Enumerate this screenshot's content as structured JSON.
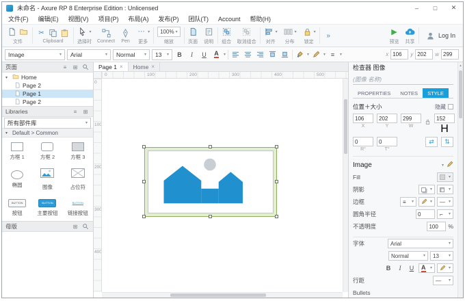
{
  "colors": {
    "accent": "#17a0dc",
    "widget_blue": "#2090cf",
    "selection_green": "#8fae5f"
  },
  "icons": {
    "chev": "▾",
    "overflow": "»",
    "cut": "✂",
    "more": "⋯",
    "play": "▶",
    "min": "–",
    "max": "□",
    "close": "✕",
    "tab_close": "×",
    "menu": "≡",
    "grid": "⊞",
    "lines": "≡",
    "dash": "—",
    "flip_h": "⇄",
    "flip_v": "⇅",
    "corner": "⌐",
    "up": "▴"
  },
  "titlebar": {
    "title": "未命名 - Axure RP 8 Enterprise Edition : Unlicensed"
  },
  "menubar": {
    "items": [
      "文件(F)",
      "编辑(E)",
      "视图(V)",
      "项目(P)",
      "布局(A)",
      "发布(P)",
      "团队(T)",
      "Account",
      "帮助(H)"
    ]
  },
  "toolbar": {
    "file": "文件",
    "clipboard": "Clipboard",
    "select_mode": "选择时",
    "connect": "Connect",
    "pen": "Pen",
    "more": "更多",
    "zoom_value": "100%",
    "zoom": "缩放",
    "page": "页面",
    "note": "说明",
    "group": "组合",
    "ungroup": "取消组合",
    "align": "对齐",
    "distribute": "分布",
    "lock": "锁定",
    "preview": "预览",
    "share": "共享",
    "login": "Log In"
  },
  "formatbar": {
    "style": "Image",
    "font": "Arial",
    "weight": "Normal",
    "size": "13",
    "bold": "B",
    "italic": "I",
    "underline": "U",
    "x_label": "x",
    "x": "106",
    "y_label": "y",
    "y": "202",
    "w_label": "w",
    "w": "299"
  },
  "pages": {
    "title": "页面",
    "items": [
      "Home",
      "Page 2",
      "Page 1",
      "Page 2"
    ]
  },
  "libraries": {
    "title": "Libraries",
    "filter": "所有部件库",
    "section": "Default > Common",
    "widgets": [
      "方框 1",
      "方框 2",
      "方框 3",
      "椭圆",
      "图像",
      "占位符",
      "按钮",
      "主要按钮",
      "链接按钮"
    ],
    "button_text": "BUTTON"
  },
  "masters": {
    "title": "母版"
  },
  "canvas": {
    "tab1": "Page 1",
    "tab2": "Home",
    "hruler": [
      "0",
      "100",
      "200",
      "300",
      "400",
      "500"
    ],
    "vruler": [
      "0",
      "100",
      "200",
      "300",
      "400"
    ]
  },
  "inspector": {
    "title": "检查器 图像",
    "name_placeholder": "(图像 名称)",
    "tab_properties": "PROPERTIES",
    "tab_notes": "NOTES",
    "tab_style": "STYLE",
    "pos": {
      "header": "位置＋大小",
      "hide": "隐藏",
      "x": "106",
      "y": "202",
      "w": "299",
      "h": "152",
      "xl": "X",
      "yl": "Y",
      "wl": "W",
      "hl": "H",
      "r": "0",
      "t": "0",
      "rl": "R°",
      "tl": "T°"
    },
    "style": {
      "section": "Image",
      "fill": "Fill",
      "shadow": "阴影",
      "border": "边框",
      "radius": "圆角半径",
      "radius_value": "0",
      "opacity": "不透明度",
      "opacity_value": "100",
      "percent": "%",
      "font": "字体",
      "font_family": "Arial",
      "font_weight": "Normal",
      "font_size": "13",
      "bold": "B",
      "italic": "I",
      "underline": "U",
      "font_color_label": "A",
      "line_spacing": "行距",
      "bullets": "Bullets"
    }
  }
}
